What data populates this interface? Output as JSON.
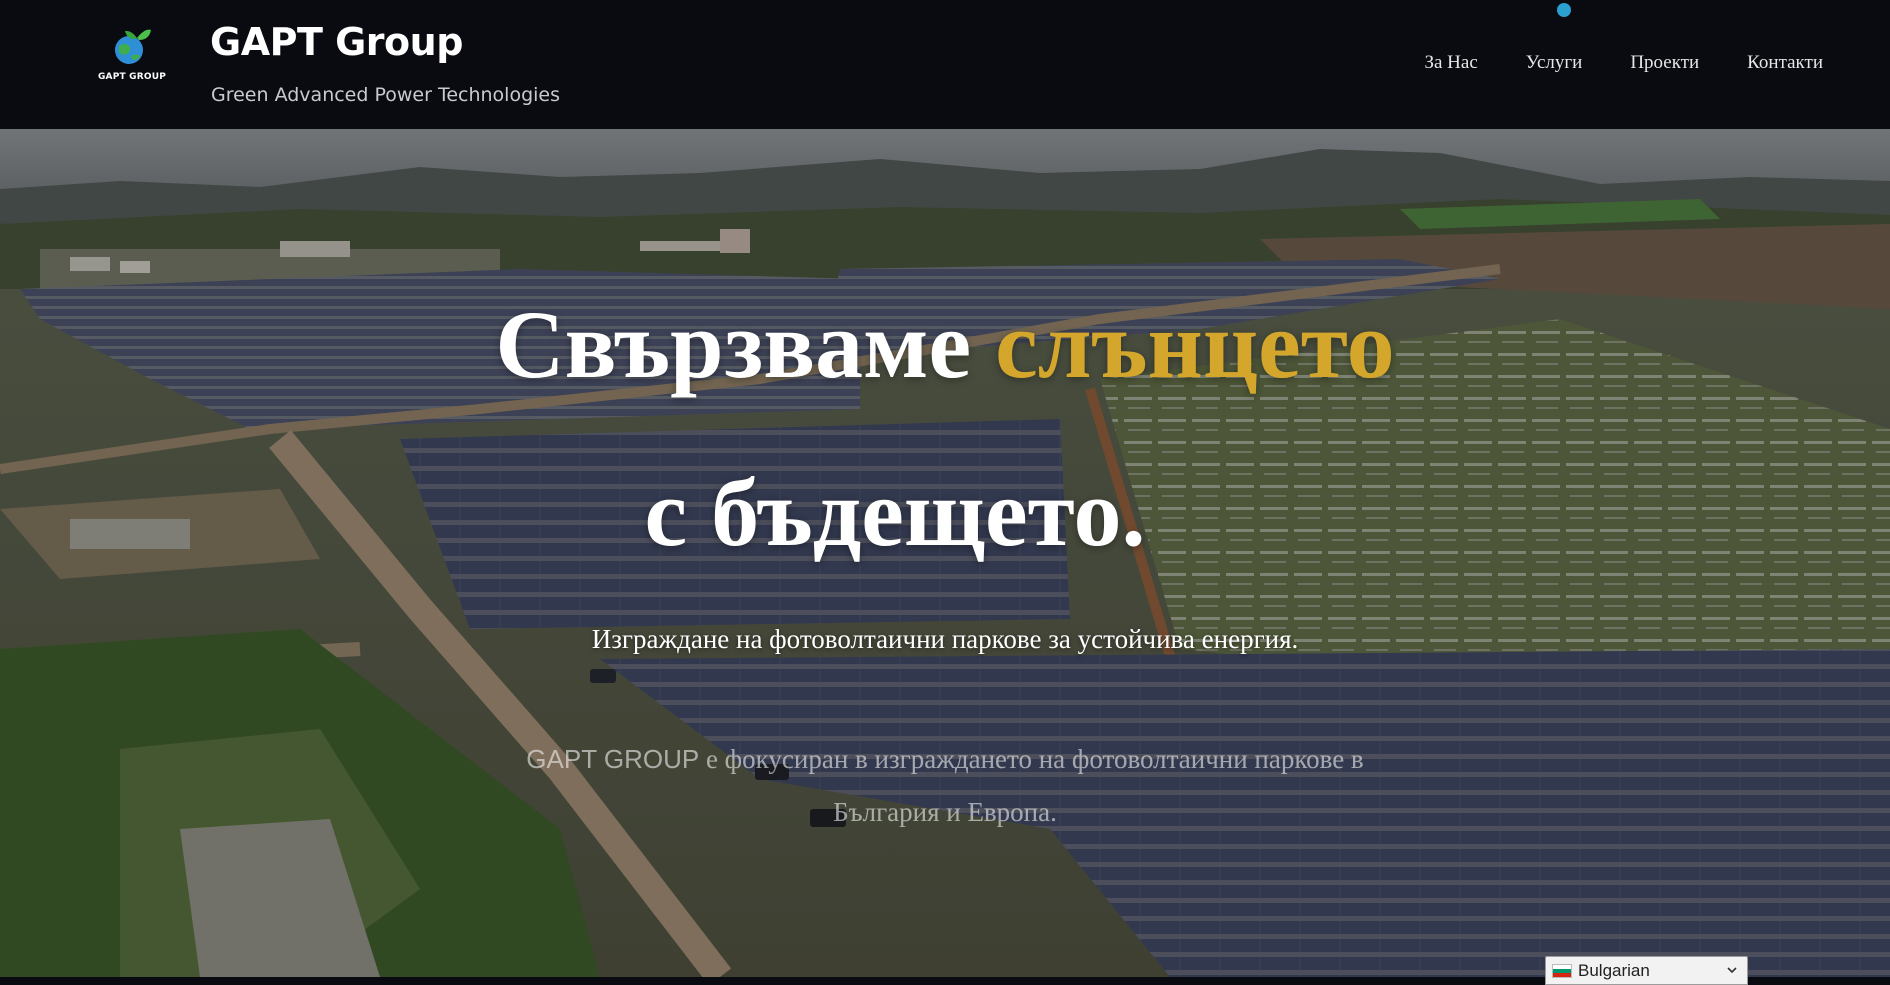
{
  "header": {
    "logo_caption": "GAPT GROUP",
    "title": "GAPT Group",
    "tagline": "Green Advanced Power Technologies",
    "nav": [
      {
        "label": "За Нас"
      },
      {
        "label": "Услуги"
      },
      {
        "label": "Проекти"
      },
      {
        "label": "Контакти"
      }
    ]
  },
  "hero": {
    "headline_part1": "Свързваме",
    "headline_accent": "слънцето",
    "headline_line2": "с бъдещето.",
    "subheadline": "Изграждане на фотоволтаични паркове за устойчива енергия.",
    "description_brand": "GAPT GROUP",
    "description_rest": " е фокусиран в изграждането на фотоволтаични паркове в България и Европа."
  },
  "language_selector": {
    "selected": "Bulgarian",
    "flag_icon": "bulgaria-flag-icon"
  },
  "colors": {
    "header_bg": "#0a0b10",
    "accent": "#d4a72c",
    "nav_dot": "#2a9fd0"
  }
}
